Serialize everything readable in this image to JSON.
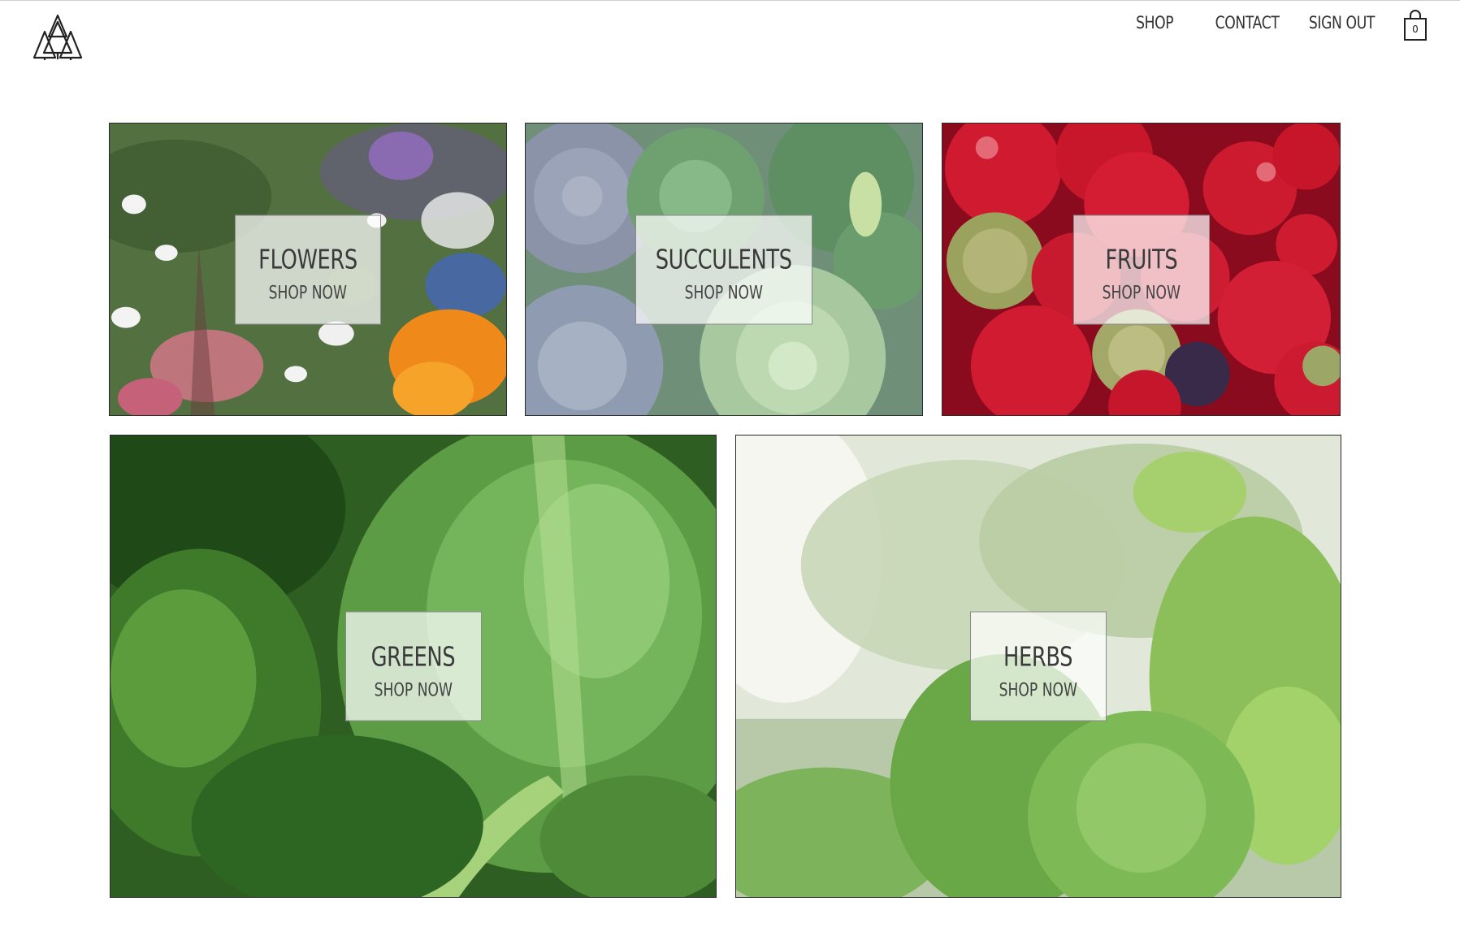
{
  "header": {
    "logo": {
      "icon": "pine-trees-logo-icon"
    },
    "nav": [
      {
        "label": "SHOP"
      },
      {
        "label": "CONTACT"
      },
      {
        "label": "SIGN OUT"
      }
    ],
    "cart": {
      "icon": "shopping-bag-icon",
      "count": "0"
    }
  },
  "categories": [
    {
      "title": "FLOWERS",
      "cta": "SHOP NOW"
    },
    {
      "title": "SUCCULENTS",
      "cta": "SHOP NOW"
    },
    {
      "title": "FRUITS",
      "cta": "SHOP NOW"
    },
    {
      "title": "GREENS",
      "cta": "SHOP NOW"
    },
    {
      "title": "HERBS",
      "cta": "SHOP NOW"
    }
  ],
  "colors": {
    "text": "#333333",
    "tile_border": "#2a2a2a",
    "label_bg": "rgba(255,255,255,0.72)"
  }
}
